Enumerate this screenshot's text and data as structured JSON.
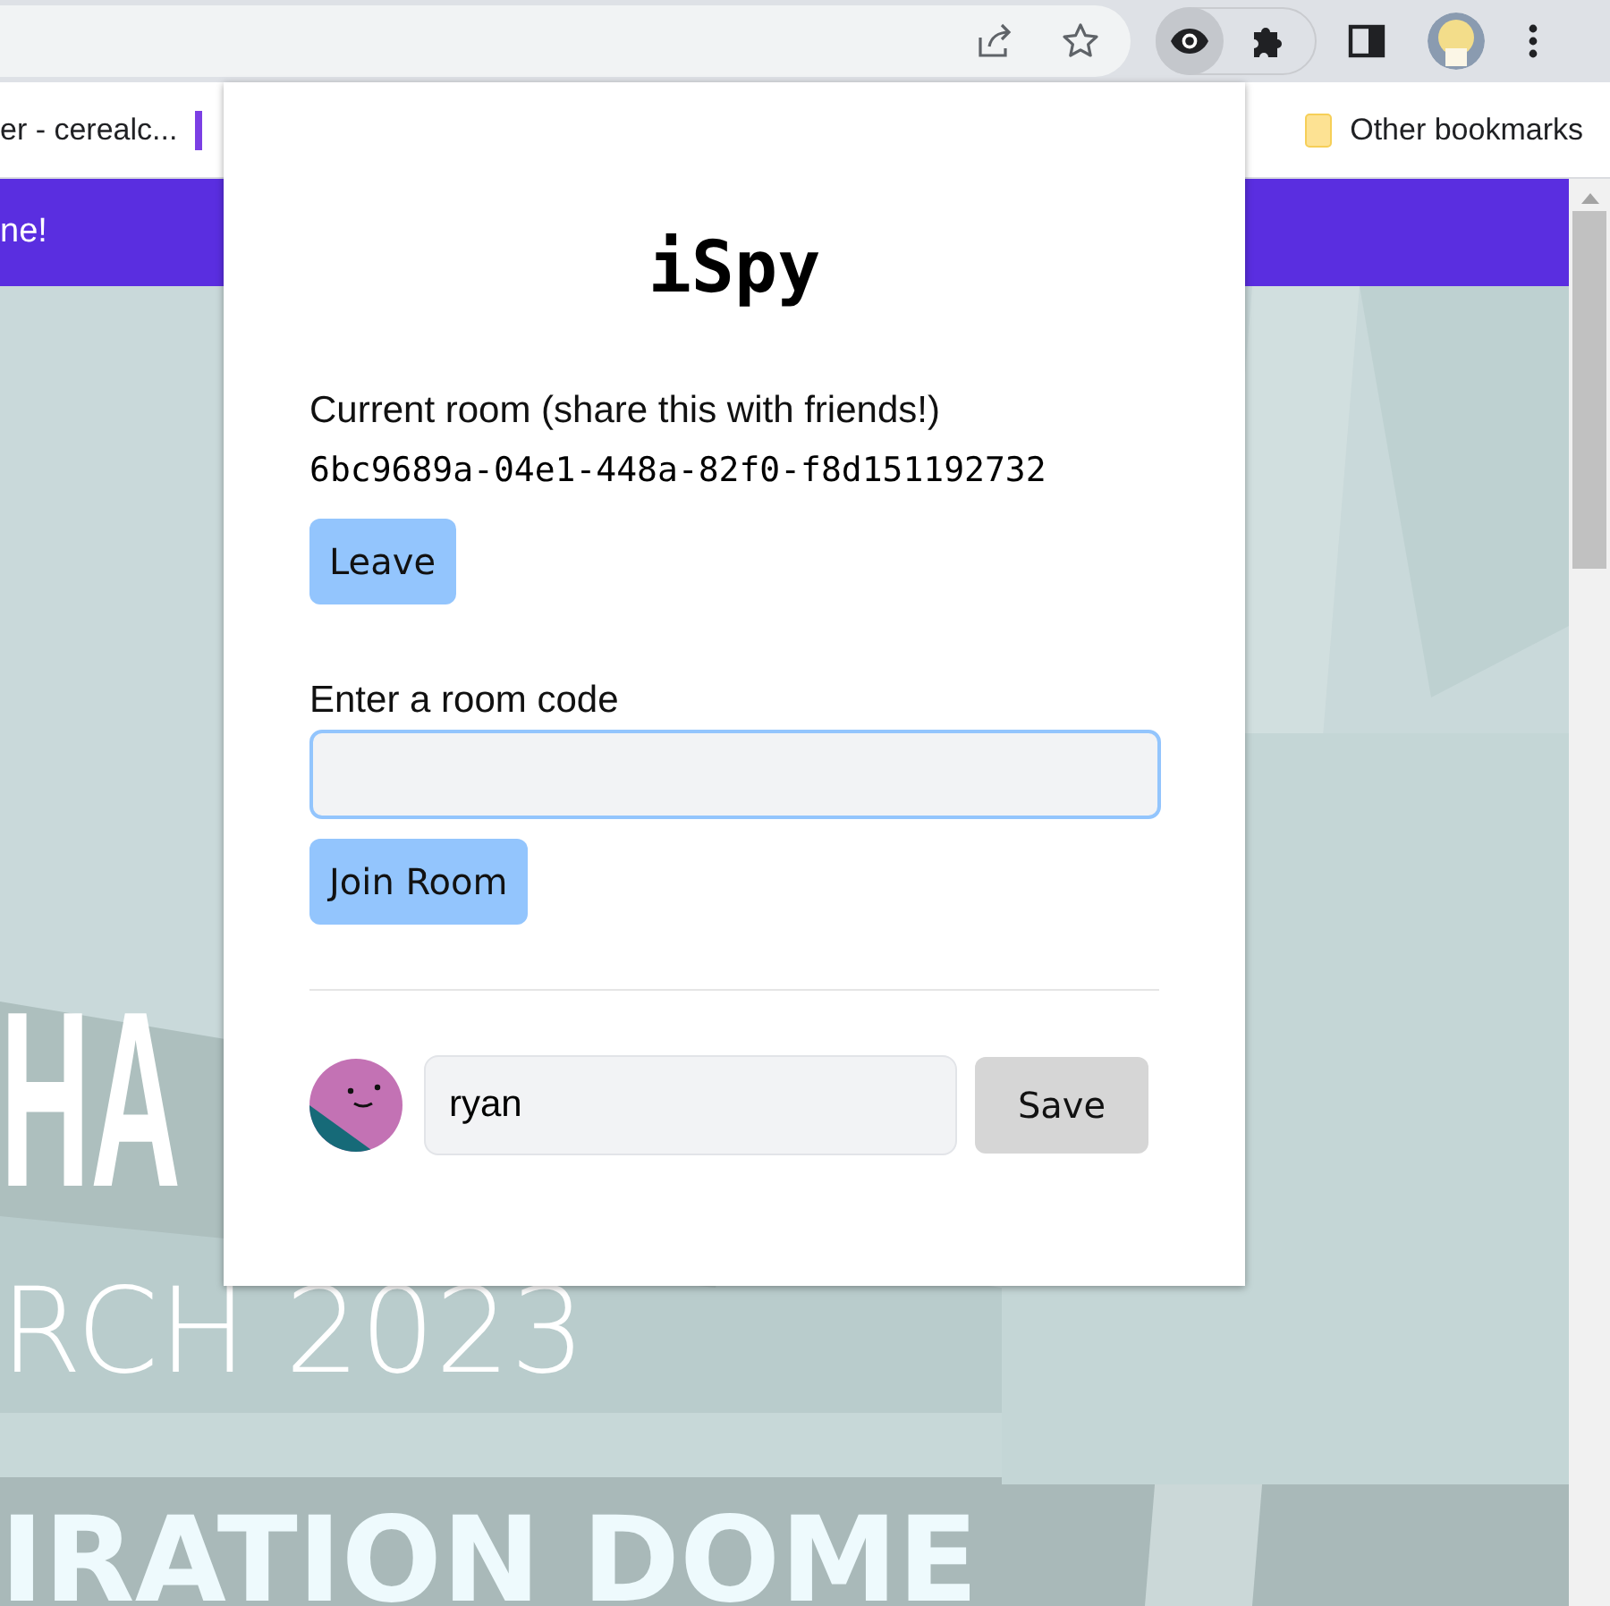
{
  "browser": {
    "bookmarks": [
      {
        "label": "er - cerealc..."
      }
    ],
    "other_bookmarks": "Other bookmarks",
    "extension_active": true
  },
  "page": {
    "banner": "ne!",
    "headline": "HA",
    "date": "RCH 2023",
    "venue": "IRATION DOME"
  },
  "popup": {
    "title": "iSpy",
    "current_room_label": "Current room (share this with friends!)",
    "room_code": "6bc9689a-04e1-448a-82f0-f8d151192732",
    "leave_button": "Leave",
    "join_label": "Enter a room code",
    "join_input": {
      "focused": true
    },
    "join_button": "Join Room",
    "profile": {
      "name": "ryan",
      "save_button": "Save"
    }
  }
}
